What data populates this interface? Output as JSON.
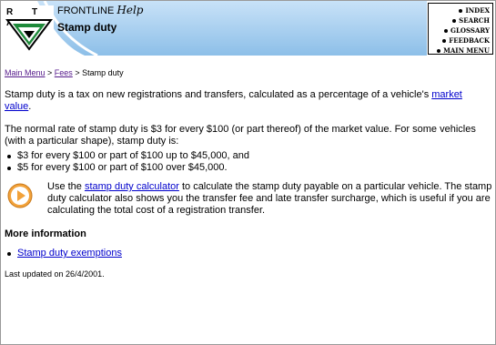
{
  "header": {
    "brand": "FRONTLINE",
    "brand_script": "Help",
    "page_title": "Stamp duty",
    "logo_text": "R T A",
    "nav": [
      "INDEX",
      "SEARCH",
      "GLOSSARY",
      "FEEDBACK",
      "MAIN MENU"
    ]
  },
  "breadcrumb": {
    "main_menu": "Main Menu",
    "sep1": " > ",
    "fees": "Fees",
    "sep2": " > ",
    "current": "Stamp duty"
  },
  "intro": {
    "text": "Stamp duty is a tax on new registrations and transfers, calculated as a percentage of a vehicle's ",
    "link": "market value",
    "end": "."
  },
  "rate": {
    "text": "The normal rate of stamp duty is $3 for every $100 (or part thereof) of the market value. For some vehicles (with a particular shape), stamp duty is:",
    "bullets": [
      "$3 for every $100 or part of $100 up to $45,000, and",
      "$5 for every $100 or part of $100 over $45,000."
    ]
  },
  "calculator": {
    "pre": "Use the ",
    "link": "stamp duty calculator",
    "post": " to calculate the stamp duty payable on a particular vehicle. The stamp duty calculator also shows you the transfer fee and late transfer surcharge, which is useful if you are calculating the total cost of a registration transfer."
  },
  "more_info": {
    "heading": "More information",
    "links": [
      "Stamp duty exemptions"
    ]
  },
  "footer": {
    "updated": "Last updated on 26/4/2001."
  },
  "colors": {
    "link": "#0000cc",
    "visited": "#551a8b",
    "header_blue": "#9ecbf2",
    "accent_orange": "#f2a23a"
  }
}
